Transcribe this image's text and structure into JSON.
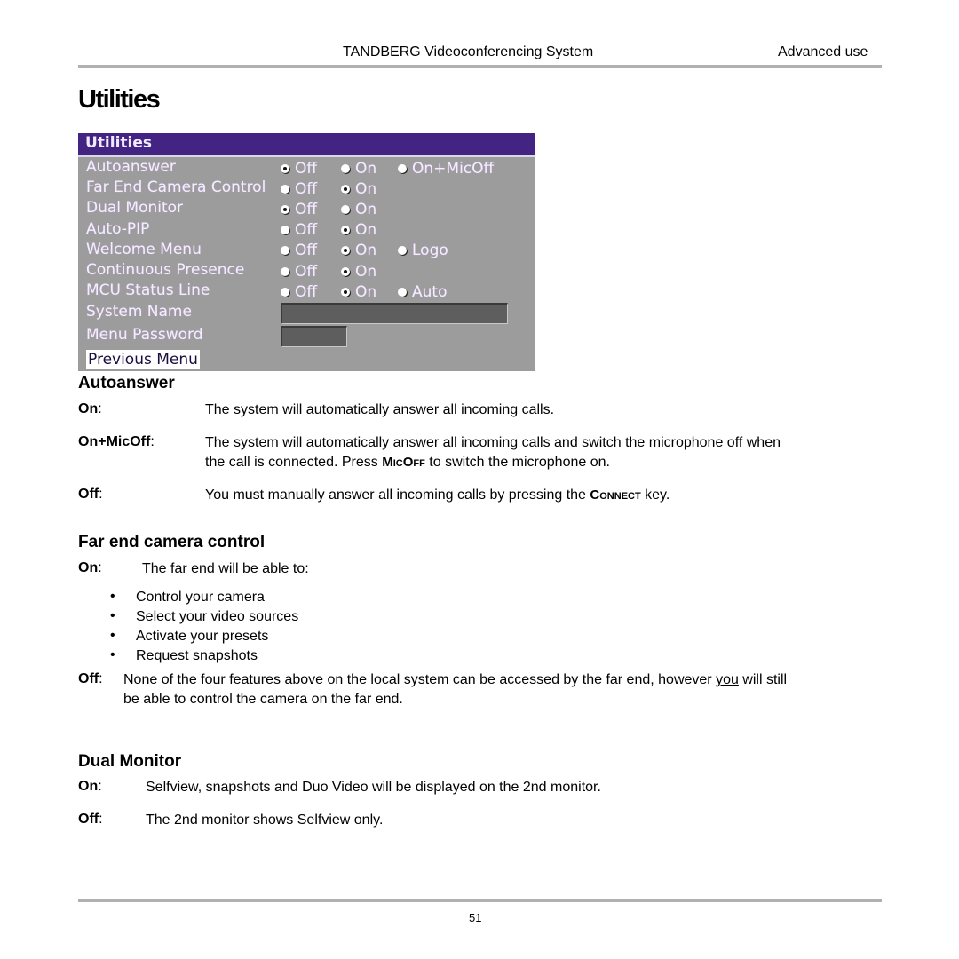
{
  "header": {
    "title": "TANDBERG Videoconferencing System",
    "section": "Advanced use"
  },
  "page_title": "Utilities",
  "menu": {
    "title": "Utilities",
    "rows": [
      {
        "label": "Autoanswer",
        "options": [
          {
            "text": "Off",
            "selected": true
          },
          {
            "text": "On",
            "selected": false
          },
          {
            "text": "On+MicOff",
            "selected": false
          }
        ]
      },
      {
        "label": "Far End Camera Control",
        "options": [
          {
            "text": "Off",
            "selected": false
          },
          {
            "text": "On",
            "selected": true
          }
        ]
      },
      {
        "label": "Dual Monitor",
        "options": [
          {
            "text": "Off",
            "selected": true
          },
          {
            "text": "On",
            "selected": false
          }
        ]
      },
      {
        "label": "Auto-PIP",
        "options": [
          {
            "text": "Off",
            "selected": false
          },
          {
            "text": "On",
            "selected": true
          }
        ]
      },
      {
        "label": "Welcome Menu",
        "options": [
          {
            "text": "Off",
            "selected": false
          },
          {
            "text": "On",
            "selected": true
          },
          {
            "text": "Logo",
            "selected": false
          }
        ]
      },
      {
        "label": "Continuous Presence",
        "options": [
          {
            "text": "Off",
            "selected": false
          },
          {
            "text": "On",
            "selected": true
          }
        ]
      },
      {
        "label": "MCU Status Line",
        "options": [
          {
            "text": "Off",
            "selected": false
          },
          {
            "text": "On",
            "selected": true
          },
          {
            "text": "Auto",
            "selected": false
          }
        ]
      }
    ],
    "system_name_label": "System Name",
    "system_name_value": "",
    "menu_password_label": "Menu Password",
    "menu_password_value": "",
    "previous_menu": "Previous Menu"
  },
  "autoanswer": {
    "heading": "Autoanswer",
    "on_term": "On",
    "on_desc": "The system will automatically answer all incoming calls.",
    "onmic_term": "On+MicOff",
    "onmic_desc1": "The system will automatically answer all incoming calls and switch the microphone off when",
    "onmic_desc2a": "the call is connected. Press ",
    "onmic_key": "MicOff",
    "onmic_desc2b": " to switch the microphone on.",
    "off_term": "Off",
    "off_desc_a": "You must manually answer all incoming calls by pressing the ",
    "off_key": "Connect",
    "off_desc_b": " key."
  },
  "far_end": {
    "heading": "Far end camera control",
    "on_term": "On",
    "on_desc": "The far end will be able to:",
    "bullets": [
      "Control your camera",
      "Select your video sources",
      "Activate your presets",
      "Request snapshots"
    ],
    "off_term": "Off",
    "off_desc1a": "None of the four features above on the local system can be accessed by the far end, however ",
    "off_desc1_u": "you",
    "off_desc1b": " will still",
    "off_desc2": "be able to control the camera on the far end."
  },
  "dual_monitor": {
    "heading": "Dual Monitor",
    "on_term": "On",
    "on_desc": "Selfview, snapshots and Duo Video will be displayed on the 2nd monitor.",
    "off_term": "Off",
    "off_desc": "The 2nd monitor  shows Selfview only."
  },
  "footer": {
    "page_number": "51"
  }
}
